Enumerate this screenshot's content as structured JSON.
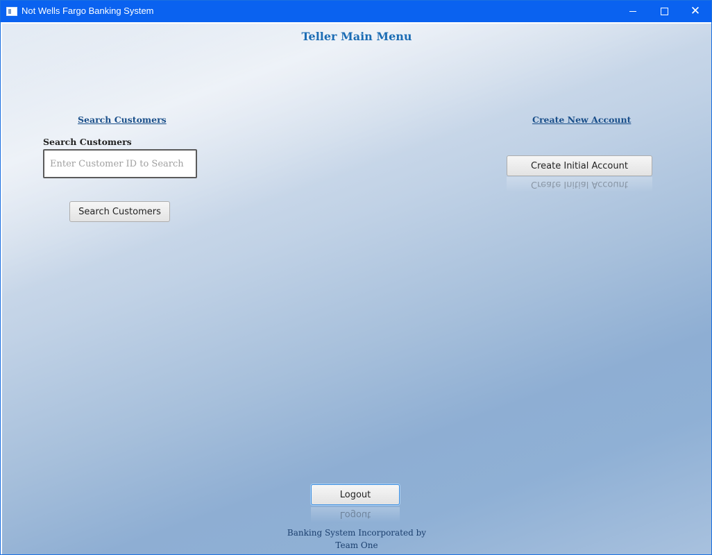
{
  "window": {
    "title": "Not Wells Fargo Banking System",
    "controls": {
      "minimize_icon": "minimize-icon",
      "maximize_icon": "maximize-icon",
      "close_icon": "close-icon",
      "close_glyph": "✕"
    }
  },
  "page": {
    "title": "Teller Main Menu"
  },
  "search_section": {
    "heading": "Search Customers",
    "field_label": "Search Customers",
    "input_value": "",
    "input_placeholder": "Enter Customer ID to Search",
    "button_label": "Search Customers"
  },
  "create_section": {
    "heading": "Create New Account",
    "button_label": "Create Initial Account"
  },
  "logout": {
    "button_label": "Logout"
  },
  "footer": {
    "line1": "Banking System Incorporated by",
    "line2": "Team One"
  },
  "colors": {
    "titlebar": "#0a62f0",
    "heading": "#1b6cb4",
    "link": "#1a4f8a"
  }
}
